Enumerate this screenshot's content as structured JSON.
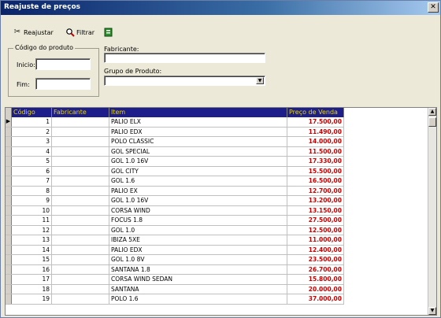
{
  "window": {
    "title": "Reajuste de preços",
    "close_glyph": "✕"
  },
  "toolbar": {
    "reajustar_label": "Reajustar",
    "reajustar_icon": "scissors-icon",
    "filtrar_label": "Filtrar",
    "filtrar_icon": "magnifier-icon",
    "export_icon": "excel-export-icon"
  },
  "filters": {
    "codigo_group_title": "Código do produto",
    "inicio_label": "Inicio:",
    "inicio_value": "",
    "fim_label": "Fim:",
    "fim_value": "",
    "fabricante_label": "Fabricante:",
    "fabricante_value": "",
    "grupo_label": "Grupo de Produto:",
    "grupo_value": ""
  },
  "grid": {
    "columns": [
      "Código",
      "Fabricante",
      "Item",
      "Preço de Venda"
    ],
    "rows": [
      {
        "codigo": "1",
        "fabricante": "",
        "item": "PALIO ELX",
        "preco": "17.500,00"
      },
      {
        "codigo": "2",
        "fabricante": "",
        "item": "PALIO EDX",
        "preco": "11.490,00"
      },
      {
        "codigo": "3",
        "fabricante": "",
        "item": "POLO CLASSIC",
        "preco": "14.000,00"
      },
      {
        "codigo": "4",
        "fabricante": "",
        "item": "GOL SPECIAL",
        "preco": "11.500,00"
      },
      {
        "codigo": "5",
        "fabricante": "",
        "item": "GOL 1.0 16V",
        "preco": "17.330,00"
      },
      {
        "codigo": "6",
        "fabricante": "",
        "item": "GOL CITY",
        "preco": "15.500,00"
      },
      {
        "codigo": "7",
        "fabricante": "",
        "item": "GOL 1.6",
        "preco": "16.500,00"
      },
      {
        "codigo": "8",
        "fabricante": "",
        "item": "PALIO EX",
        "preco": "12.700,00"
      },
      {
        "codigo": "9",
        "fabricante": "",
        "item": "GOL 1.0 16V",
        "preco": "13.200,00"
      },
      {
        "codigo": "10",
        "fabricante": "",
        "item": "CORSA WIND",
        "preco": "13.150,00"
      },
      {
        "codigo": "11",
        "fabricante": "",
        "item": "FOCUS 1.8",
        "preco": "27.500,00"
      },
      {
        "codigo": "12",
        "fabricante": "",
        "item": "GOL 1.0",
        "preco": "12.500,00"
      },
      {
        "codigo": "13",
        "fabricante": "",
        "item": "IBIZA 5XE",
        "preco": "11.000,00"
      },
      {
        "codigo": "14",
        "fabricante": "",
        "item": "PALIO EDX",
        "preco": "12.400,00"
      },
      {
        "codigo": "15",
        "fabricante": "",
        "item": "GOL 1.0 8V",
        "preco": "23.500,00"
      },
      {
        "codigo": "16",
        "fabricante": "",
        "item": "SANTANA 1.8",
        "preco": "26.700,00"
      },
      {
        "codigo": "17",
        "fabricante": "",
        "item": "CORSA WIND SEDAN",
        "preco": "15.800,00"
      },
      {
        "codigo": "18",
        "fabricante": "",
        "item": "SANTANA",
        "preco": "20.000,00"
      },
      {
        "codigo": "19",
        "fabricante": "",
        "item": "POLO 1.6",
        "preco": "37.000,00"
      }
    ],
    "current_row_marker": "▶"
  },
  "colors": {
    "header_bg": "#1e1e8a",
    "header_text": "#e8d800",
    "price_text": "#cc0000"
  }
}
